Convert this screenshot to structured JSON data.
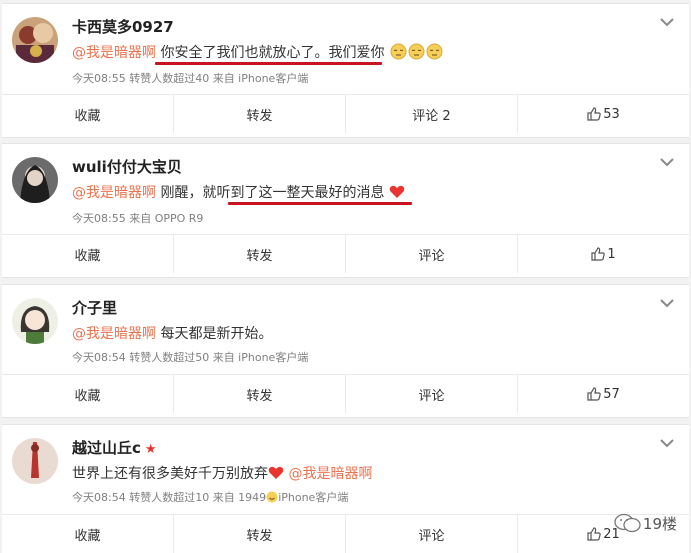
{
  "posts": [
    {
      "username": "卡西莫多0927",
      "mention": "@我是暗器啊",
      "text": "你安全了我们也就放心了。我们爱你",
      "meta": "今天08:55 转赞人数超过40 来自 iPhone客户端",
      "actions": {
        "collect": "收藏",
        "repost": "转发",
        "comment": "评论 2",
        "like": "53"
      }
    },
    {
      "username": "wuli付付大宝贝",
      "mention": "@我是暗器啊",
      "text": "刚醒，就听到了这一整天最好的消息",
      "meta": "今天08:55 来自 OPPO R9",
      "actions": {
        "collect": "收藏",
        "repost": "转发",
        "comment": "评论",
        "like": "1"
      }
    },
    {
      "username": "介子里",
      "mention": "@我是暗器啊",
      "text": "每天都是新开始。",
      "meta": "今天08:54 转赞人数超过50 来自 iPhone客户端",
      "actions": {
        "collect": "收藏",
        "repost": "转发",
        "comment": "评论",
        "like": "57"
      }
    },
    {
      "username": "越过山丘c",
      "mention": "@我是暗器啊",
      "text": "世界上还有很多美好千万别放弃",
      "meta_prefix": "今天08:54 转赞人数超过10 来自 1949",
      "meta_suffix": "iPhone客户端",
      "actions": {
        "collect": "收藏",
        "repost": "转发",
        "comment": "评论",
        "like": "21"
      }
    }
  ],
  "watermark": "19楼",
  "colors": {
    "mention": "#eb7350",
    "underline": "#c8141e",
    "heart": "#e8352f"
  }
}
